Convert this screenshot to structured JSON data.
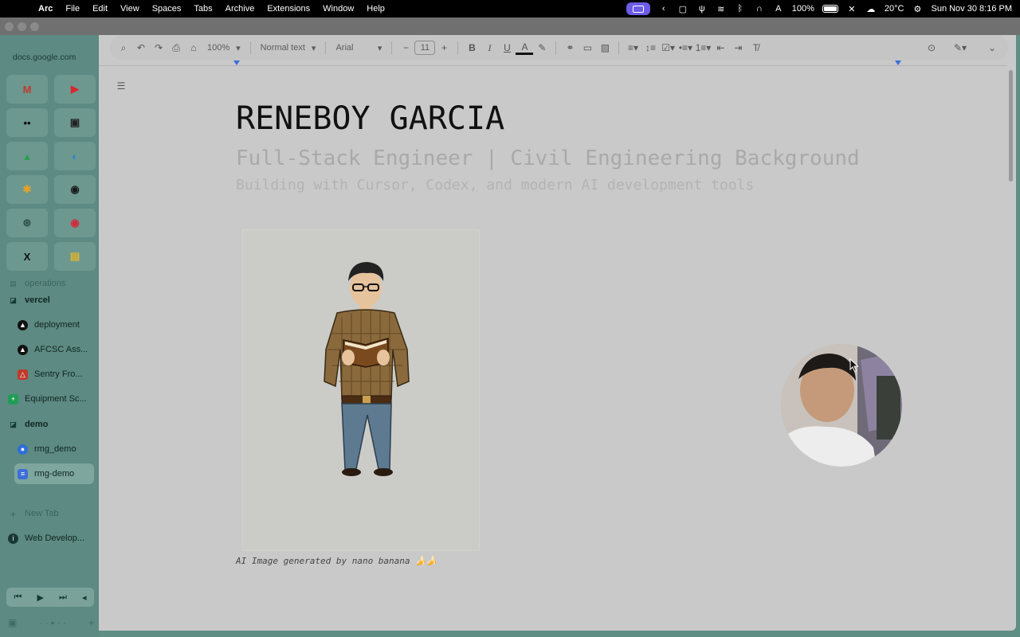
{
  "menubar": {
    "app": "Arc",
    "items": [
      "File",
      "Edit",
      "View",
      "Spaces",
      "Tabs",
      "Archive",
      "Extensions",
      "Window",
      "Help"
    ],
    "battery": "100%",
    "weather": "20°C",
    "datetime": "Sun Nov 30  8:16 PM"
  },
  "sidebar": {
    "url": "docs.google.com",
    "favorites": [
      {
        "icon": "gmail-icon",
        "glyph": "M",
        "color": "#c0392b"
      },
      {
        "icon": "youtube-icon",
        "glyph": "▶",
        "color": "#d8262d"
      },
      {
        "icon": "eyes-icon",
        "glyph": "••",
        "color": "#111111"
      },
      {
        "icon": "terminal-icon",
        "glyph": "▣",
        "color": "#222222"
      },
      {
        "icon": "google-drive-icon",
        "glyph": "▲",
        "color": "#2d9f55"
      },
      {
        "icon": "edge-icon",
        "glyph": "◐",
        "color": "#2f7fd8"
      },
      {
        "icon": "google-photos-icon",
        "glyph": "✱",
        "color": "#e4a12b"
      },
      {
        "icon": "github-icon",
        "glyph": "◉",
        "color": "#1b1b1b"
      },
      {
        "icon": "openai-icon",
        "glyph": "⊛",
        "color": "#2f4f49"
      },
      {
        "icon": "youtube-music-icon",
        "glyph": "◉",
        "color": "#d5283a"
      },
      {
        "icon": "x-icon",
        "glyph": "X",
        "color": "#111111"
      },
      {
        "icon": "notes-icon",
        "glyph": "▤",
        "color": "#e0b32e"
      }
    ],
    "operations_label": "operations",
    "vercel_label": "vercel",
    "vercel_items": [
      "deployment",
      "AFCSC Ass...",
      "Sentry Fro..."
    ],
    "equipment_label": "Equipment Sc...",
    "demo_label": "demo",
    "demo_items": [
      "rmg_demo",
      "rmg-demo"
    ],
    "new_tab_label": "New Tab",
    "web_dev_label": "Web Develop..."
  },
  "toolbar": {
    "zoom": "100%",
    "style": "Normal text",
    "font": "Arial",
    "font_size": "11"
  },
  "document": {
    "title": "RENEBOY GARCIA",
    "subtitle": "Full-Stack Engineer | Civil Engineering Background",
    "tagline": "Building with Cursor, Codex, and modern AI development tools",
    "caption": "AI Image generated by nano banana 🍌🍌"
  }
}
